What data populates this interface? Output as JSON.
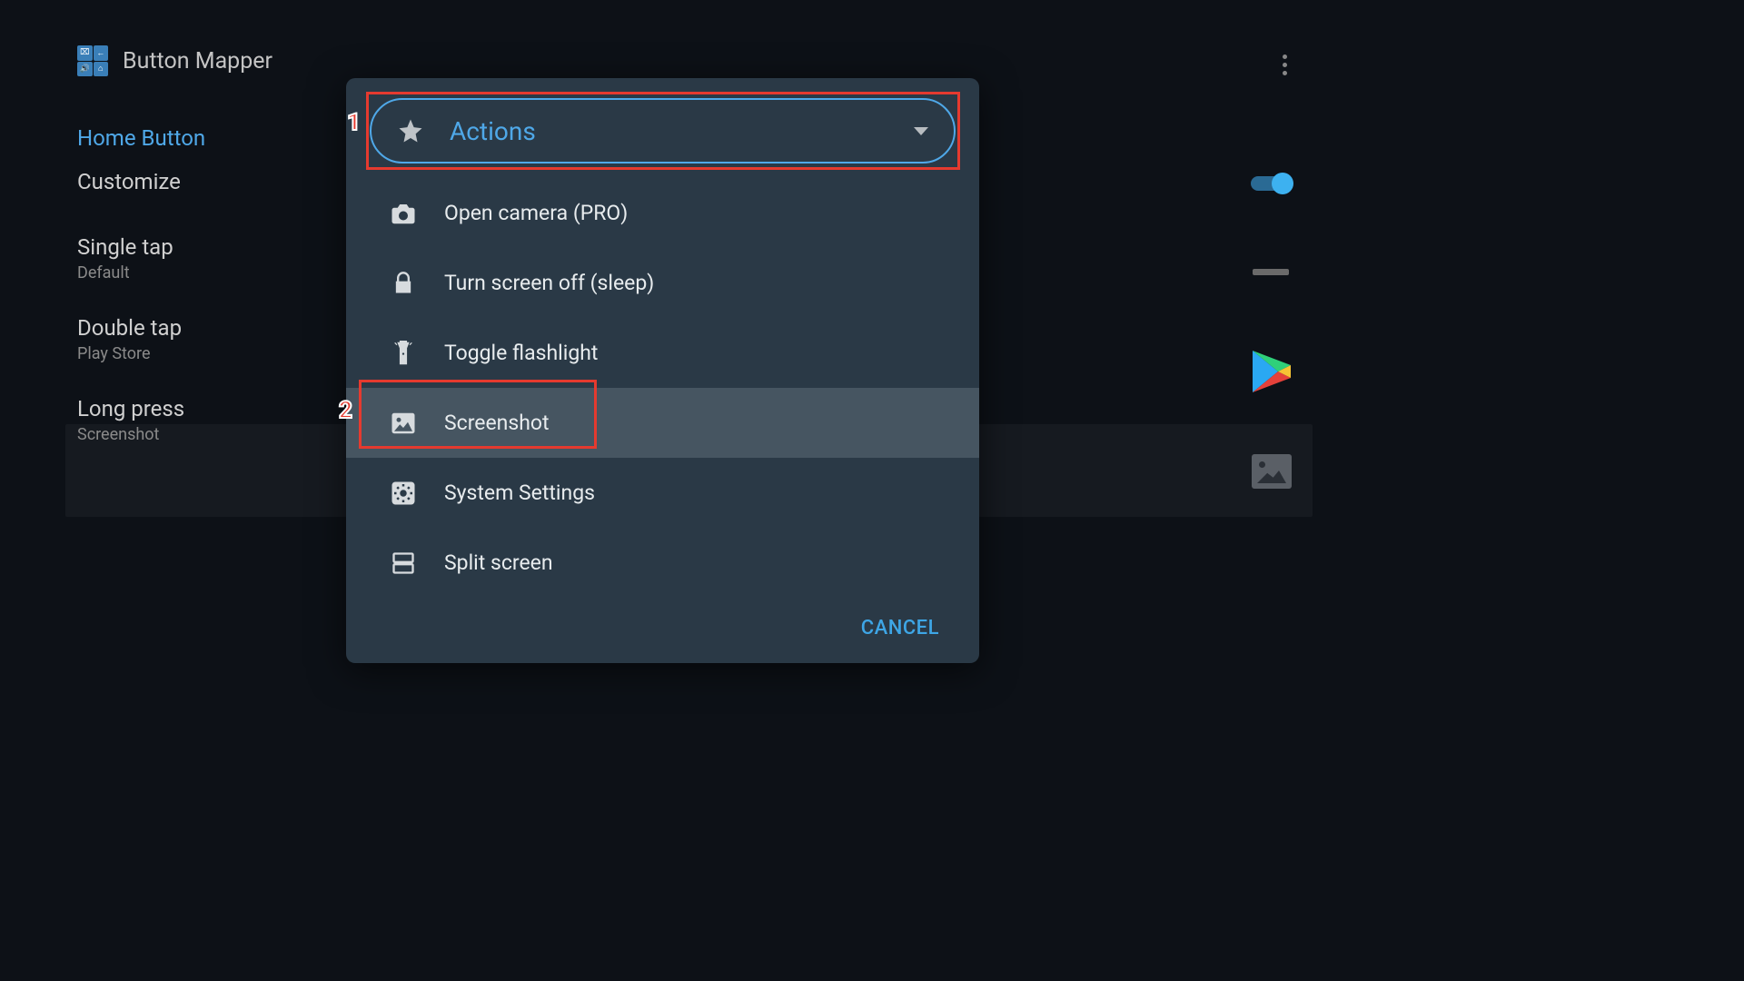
{
  "header": {
    "title": "Button Mapper"
  },
  "sidebar": {
    "active": "Home Button",
    "customize": "Customize",
    "single_tap": {
      "label": "Single tap",
      "value": "Default"
    },
    "double_tap": {
      "label": "Double tap",
      "value": "Play Store"
    },
    "long_press": {
      "label": "Long press",
      "value": "Screenshot"
    }
  },
  "dialog": {
    "dropdown_label": "Actions",
    "items": [
      {
        "label": "Open camera (PRO)"
      },
      {
        "label": "Turn screen off (sleep)"
      },
      {
        "label": "Toggle flashlight"
      },
      {
        "label": "Screenshot"
      },
      {
        "label": "System Settings"
      },
      {
        "label": "Split screen"
      }
    ],
    "cancel": "CANCEL"
  },
  "annotations": {
    "one": "1",
    "two": "2"
  }
}
